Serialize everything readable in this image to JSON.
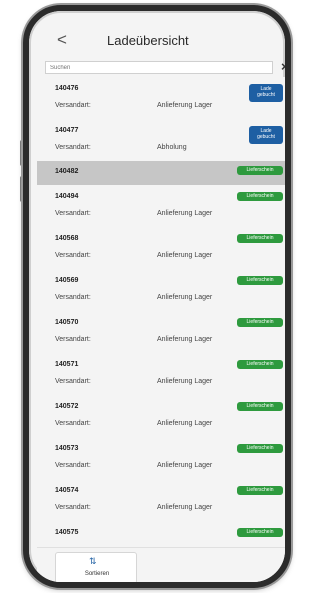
{
  "header": {
    "back_symbol": "<",
    "title": "Ladeübersicht"
  },
  "search": {
    "placeholder": "Suchen",
    "clear_symbol": "×"
  },
  "list": {
    "items": [
      {
        "id": "140476",
        "label": "Versandart:",
        "value": "Anlieferung Lager",
        "status": "Lade\ngebucht",
        "status_color": "#1e5fa3",
        "selected": false
      },
      {
        "id": "140477",
        "label": "Versandart:",
        "value": "Abholung",
        "status": "Lade\ngebucht",
        "status_color": "#1e5fa3",
        "selected": false
      },
      {
        "id": "140482",
        "label": "",
        "value": "",
        "status": "Lieferschein",
        "status_color": "#2e9a3e",
        "selected": true
      },
      {
        "id": "140494",
        "label": "Versandart:",
        "value": "Anlieferung Lager",
        "status": "Lieferschein",
        "status_color": "#2e9a3e",
        "selected": false
      },
      {
        "id": "140568",
        "label": "Versandart:",
        "value": "Anlieferung Lager",
        "status": "Lieferschein",
        "status_color": "#2e9a3e",
        "selected": false
      },
      {
        "id": "140569",
        "label": "Versandart:",
        "value": "Anlieferung Lager",
        "status": "Lieferschein",
        "status_color": "#2e9a3e",
        "selected": false
      },
      {
        "id": "140570",
        "label": "Versandart:",
        "value": "Anlieferung Lager",
        "status": "Lieferschein",
        "status_color": "#2e9a3e",
        "selected": false
      },
      {
        "id": "140571",
        "label": "Versandart:",
        "value": "Anlieferung Lager",
        "status": "Lieferschein",
        "status_color": "#2e9a3e",
        "selected": false
      },
      {
        "id": "140572",
        "label": "Versandart:",
        "value": "Anlieferung Lager",
        "status": "Lieferschein",
        "status_color": "#2e9a3e",
        "selected": false
      },
      {
        "id": "140573",
        "label": "Versandart:",
        "value": "Anlieferung Lager",
        "status": "Lieferschein",
        "status_color": "#2e9a3e",
        "selected": false
      },
      {
        "id": "140574",
        "label": "Versandart:",
        "value": "Anlieferung Lager",
        "status": "Lieferschein",
        "status_color": "#2e9a3e",
        "selected": false
      },
      {
        "id": "140575",
        "label": "",
        "value": "",
        "status": "Lieferschein",
        "status_color": "#2e9a3e",
        "selected": false
      }
    ],
    "chevron": ">"
  },
  "bottom": {
    "sort_label": "Sortieren",
    "sort_icon": "sort-arrows-icon"
  }
}
